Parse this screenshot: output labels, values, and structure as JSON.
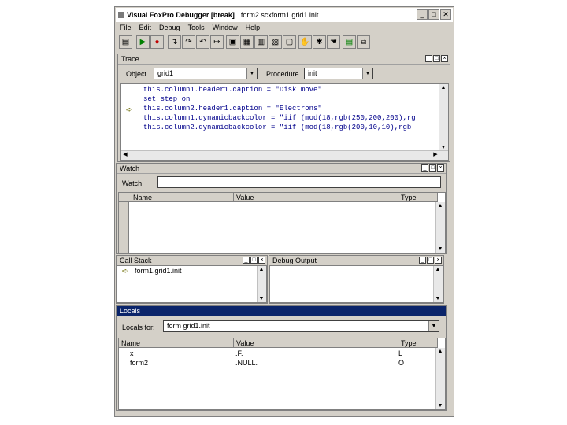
{
  "window": {
    "title": "Visual FoxPro Debugger [break]",
    "subtitle": "form2.scxform1.grid1.init"
  },
  "menu": [
    "File",
    "Edit",
    "Debug",
    "Tools",
    "Window",
    "Help"
  ],
  "trace": {
    "title": "Trace",
    "object_label": "Object",
    "object_value": "grid1",
    "procedure_label": "Procedure",
    "procedure_value": "init",
    "lines": [
      "this.column1.header1.caption = \"Disk move\"",
      "set step on",
      "this.column2.header1.caption = \"Electrons\"",
      "this.column1.dynamicbackcolor = \"iif (mod(18,rgb(250,200,200),rg",
      "this.column2.dynamicbackcolor = \"iif (mod(18,rgb(200,10,10),rgb"
    ],
    "current_line_marker": "➪"
  },
  "watch": {
    "title": "Watch",
    "label": "Watch",
    "columns": [
      "Name",
      "Value",
      "Type"
    ]
  },
  "call_stack": {
    "title": "Call Stack",
    "items": [
      "form1.grid1.init"
    ]
  },
  "debug_output": {
    "title": "Debug Output"
  },
  "locals": {
    "title": "Locals",
    "label": "Locals for:",
    "value": "form   grid1.init",
    "columns": [
      "Name",
      "Value",
      "Type"
    ],
    "rows": [
      {
        "name": "x",
        "value": ".F.",
        "type": "L"
      },
      {
        "name": "form2",
        "value": ".NULL.",
        "type": "O"
      }
    ]
  }
}
